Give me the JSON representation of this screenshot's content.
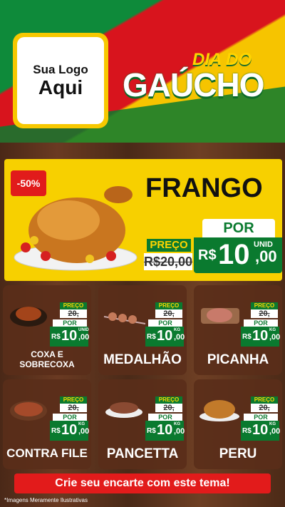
{
  "header": {
    "logo_line1": "Sua Logo",
    "logo_line2": "Aqui",
    "title_top": "DIA DO",
    "title_main": "GAÚCHO"
  },
  "hero": {
    "discount": "-50%",
    "name": "FRANGO",
    "por": "POR",
    "preco_label": "PREÇO",
    "old_price": "R$20,00",
    "currency": "R$",
    "price_int": "10",
    "price_dec": ",00",
    "unit": "UNID"
  },
  "products": [
    {
      "name": "COXA E SOBRECOXA",
      "preco_label": "PREÇO",
      "old_price": "20,",
      "por": "POR",
      "currency": "R$",
      "price_int": "10",
      "price_dec": ",00",
      "unit": "UNID"
    },
    {
      "name": "MEDALHÃO",
      "preco_label": "PREÇO",
      "old_price": "20,",
      "por": "POR",
      "currency": "R$",
      "price_int": "10",
      "price_dec": ",00",
      "unit": "KG"
    },
    {
      "name": "PICANHA",
      "preco_label": "PREÇO",
      "old_price": "20,",
      "por": "POR",
      "currency": "R$",
      "price_int": "10",
      "price_dec": ",00",
      "unit": "KG"
    },
    {
      "name": "CONTRA FILE",
      "preco_label": "PREÇO",
      "old_price": "20,",
      "por": "POR",
      "currency": "R$",
      "price_int": "10",
      "price_dec": ",00",
      "unit": "KG"
    },
    {
      "name": "PANCETTA",
      "preco_label": "PREÇO",
      "old_price": "20,",
      "por": "POR",
      "currency": "R$",
      "price_int": "10",
      "price_dec": ",00",
      "unit": "KG"
    },
    {
      "name": "PERU",
      "preco_label": "PREÇO",
      "old_price": "20,",
      "por": "POR",
      "currency": "R$",
      "price_int": "10",
      "price_dec": ",00",
      "unit": "KG"
    }
  ],
  "cta": "Crie seu encarte com este tema!",
  "footnote": "*Imagens Meramente Ilustrativas",
  "colors": {
    "green": "#0a7a2f",
    "red": "#d8141d",
    "yellow": "#f6c400"
  }
}
